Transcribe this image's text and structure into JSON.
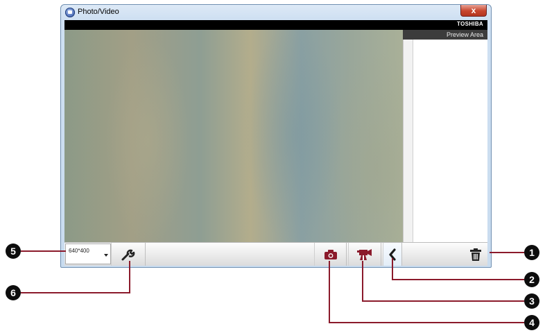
{
  "window": {
    "title": "Photo/Video",
    "close_symbol": "x"
  },
  "header": {
    "brand": "TOSHIBA"
  },
  "preview": {
    "label": "Preview Area"
  },
  "toolbar": {
    "resolution_value": "640*400",
    "icons": {
      "settings": "wrench-icon",
      "photo": "camera-icon",
      "video": "video-camera-icon",
      "back": "chevron-left-icon",
      "delete": "trash-icon"
    },
    "accent_color": "#8b1a2b"
  },
  "callouts": [
    "1",
    "2",
    "3",
    "4",
    "5",
    "6"
  ],
  "colors": {
    "callout_line": "#8b1a2b",
    "header_bar": "#000000",
    "preview_header": "#3c3c3c"
  }
}
